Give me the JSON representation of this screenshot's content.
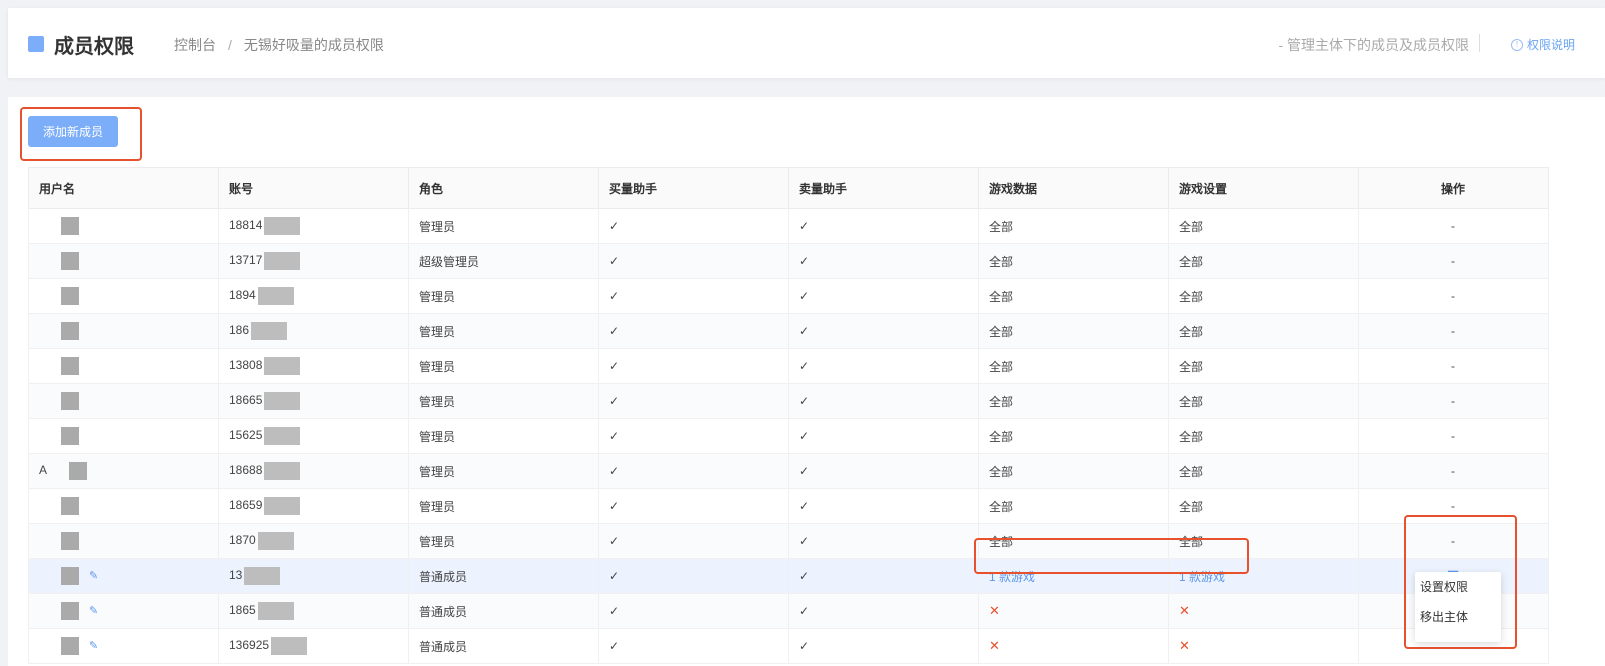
{
  "header": {
    "title": "成员权限",
    "breadcrumb": [
      "控制台",
      "无锡好吸量的成员权限"
    ],
    "breadcrumb_sep": "/",
    "subtitle": "- 管理主体下的成员及成员权限",
    "help_label": "权限说明"
  },
  "toolbar": {
    "add_label": "添加新成员"
  },
  "table": {
    "columns": [
      "用户名",
      "账号",
      "角色",
      "买量助手",
      "卖量助手",
      "游戏数据",
      "游戏设置",
      "操作"
    ],
    "rows": [
      {
        "user": "",
        "account": "18814",
        "role": "管理员",
        "buy": "✓",
        "sell": "✓",
        "data": "全部",
        "settings": "全部",
        "op": "-"
      },
      {
        "user": "",
        "account": "13717",
        "role": "超级管理员",
        "buy": "✓",
        "sell": "✓",
        "data": "全部",
        "settings": "全部",
        "op": "-"
      },
      {
        "user": "",
        "account": "1894",
        "role": "管理员",
        "buy": "✓",
        "sell": "✓",
        "data": "全部",
        "settings": "全部",
        "op": "-"
      },
      {
        "user": "",
        "account": "186",
        "role": "管理员",
        "buy": "✓",
        "sell": "✓",
        "data": "全部",
        "settings": "全部",
        "op": "-"
      },
      {
        "user": "",
        "account": "13808",
        "role": "管理员",
        "buy": "✓",
        "sell": "✓",
        "data": "全部",
        "settings": "全部",
        "op": "-"
      },
      {
        "user": "",
        "account": "18665",
        "role": "管理员",
        "buy": "✓",
        "sell": "✓",
        "data": "全部",
        "settings": "全部",
        "op": "-"
      },
      {
        "user": "",
        "account": "15625",
        "role": "管理员",
        "buy": "✓",
        "sell": "✓",
        "data": "全部",
        "settings": "全部",
        "op": "-"
      },
      {
        "user": "A",
        "account": "18688",
        "role": "管理员",
        "buy": "✓",
        "sell": "✓",
        "data": "全部",
        "settings": "全部",
        "op": "-"
      },
      {
        "user": "",
        "account": "18659",
        "role": "管理员",
        "buy": "✓",
        "sell": "✓",
        "data": "全部",
        "settings": "全部",
        "op": "-"
      },
      {
        "user": "",
        "account": "1870",
        "role": "管理员",
        "buy": "✓",
        "sell": "✓",
        "data": "全部",
        "settings": "全部",
        "op": "-"
      },
      {
        "user": "",
        "account": "13",
        "role": "普通成员",
        "buy": "✓",
        "sell": "✓",
        "data": "1 款游戏",
        "settings": "1 款游戏",
        "op": "☰"
      },
      {
        "user": "",
        "account": "1865",
        "role": "普通成员",
        "buy": "✓",
        "sell": "✓",
        "data": "✕",
        "settings": "✕",
        "op": ""
      },
      {
        "user": "",
        "account": "136925",
        "role": "普通成员",
        "buy": "✓",
        "sell": "✓",
        "data": "✕",
        "settings": "✕",
        "op": ""
      }
    ]
  },
  "menu": {
    "items": [
      "设置权限",
      "移出主体"
    ]
  },
  "colors": {
    "accent": "#7cadf9",
    "link": "#5d97ee",
    "highlight": "#e8512e",
    "error": "#e8512e"
  }
}
